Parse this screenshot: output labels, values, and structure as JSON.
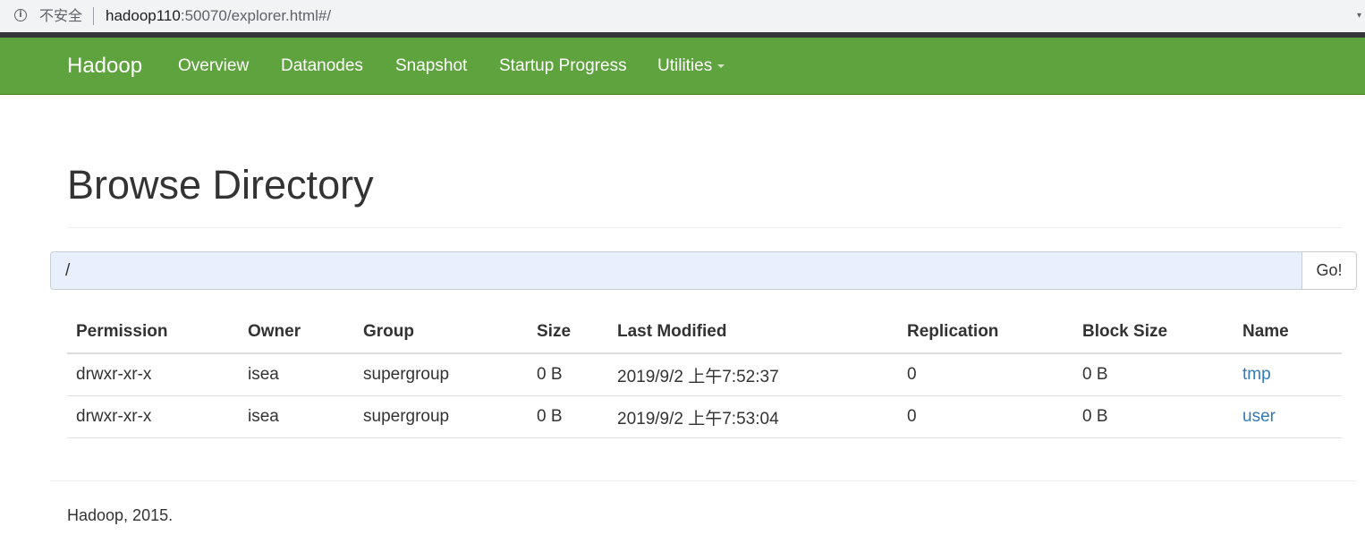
{
  "browser": {
    "security_label": "不安全",
    "url_host": "hadoop110",
    "url_rest": ":50070/explorer.html#/"
  },
  "navbar": {
    "brand": "Hadoop",
    "items": [
      {
        "label": "Overview"
      },
      {
        "label": "Datanodes"
      },
      {
        "label": "Snapshot"
      },
      {
        "label": "Startup Progress"
      },
      {
        "label": "Utilities"
      }
    ]
  },
  "page": {
    "title": "Browse Directory"
  },
  "path_bar": {
    "value": "/",
    "go_label": "Go!"
  },
  "table": {
    "headers": [
      "Permission",
      "Owner",
      "Group",
      "Size",
      "Last Modified",
      "Replication",
      "Block Size",
      "Name"
    ],
    "rows": [
      [
        "drwxr-xr-x",
        "isea",
        "supergroup",
        "0 B",
        "2019/9/2 上午7:52:37",
        "0",
        "0 B",
        "tmp"
      ],
      [
        "drwxr-xr-x",
        "isea",
        "supergroup",
        "0 B",
        "2019/9/2 上午7:53:04",
        "0",
        "0 B",
        "user"
      ]
    ]
  },
  "footer": {
    "text": "Hadoop, 2015."
  },
  "colors": {
    "navbar_bg": "#5fa33e",
    "link": "#337ab7",
    "input_bg": "#e8f0fe"
  }
}
